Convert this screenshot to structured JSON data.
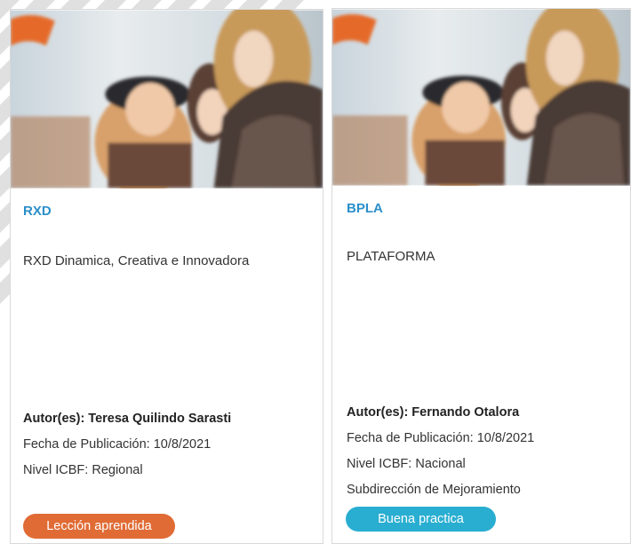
{
  "cards": [
    {
      "title": "RXD",
      "description": "RXD Dinamica, Creativa e Innovadora",
      "author": "Autor(es): Teresa Quilindo Sarasti",
      "date": "Fecha de Publicación: 10/8/2021",
      "level": "Nivel ICBF: Regional",
      "tag": "Lección aprendida",
      "tag_color": "#e06b35"
    },
    {
      "title": "BPLA",
      "description": "PLATAFORMA",
      "author": "Autor(es): Fernando Otalora",
      "date": "Fecha de Publicación: 10/8/2021",
      "level": "Nivel ICBF: Nacional",
      "subdirection": "Subdirección de Mejoramiento",
      "tag": "Buena practica",
      "tag_color": "#29aed1"
    }
  ],
  "colors": {
    "title": "#2b8fc9",
    "card_border": "#d9d9d9"
  }
}
